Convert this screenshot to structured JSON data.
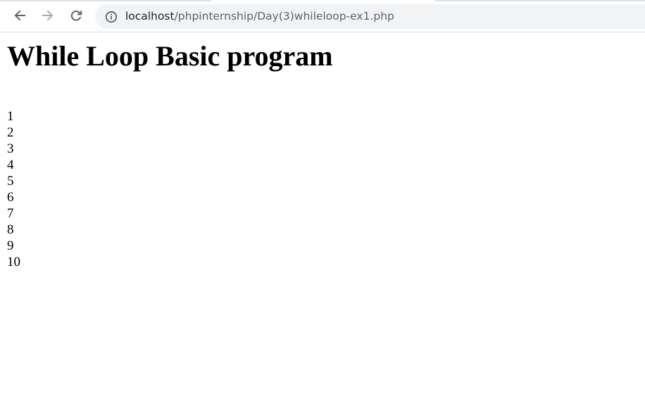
{
  "browser": {
    "back_icon": "arrow-left-icon",
    "forward_icon": "arrow-right-icon",
    "reload_icon": "reload-icon",
    "site_info_icon": "info-circle-icon",
    "url_host": "localhost",
    "url_path": "/phpinternship/Day(3)whileloop-ex1.php"
  },
  "page": {
    "title": "While Loop Basic program",
    "numbers": [
      "1",
      "2",
      "3",
      "4",
      "5",
      "6",
      "7",
      "8",
      "9",
      "10"
    ]
  }
}
